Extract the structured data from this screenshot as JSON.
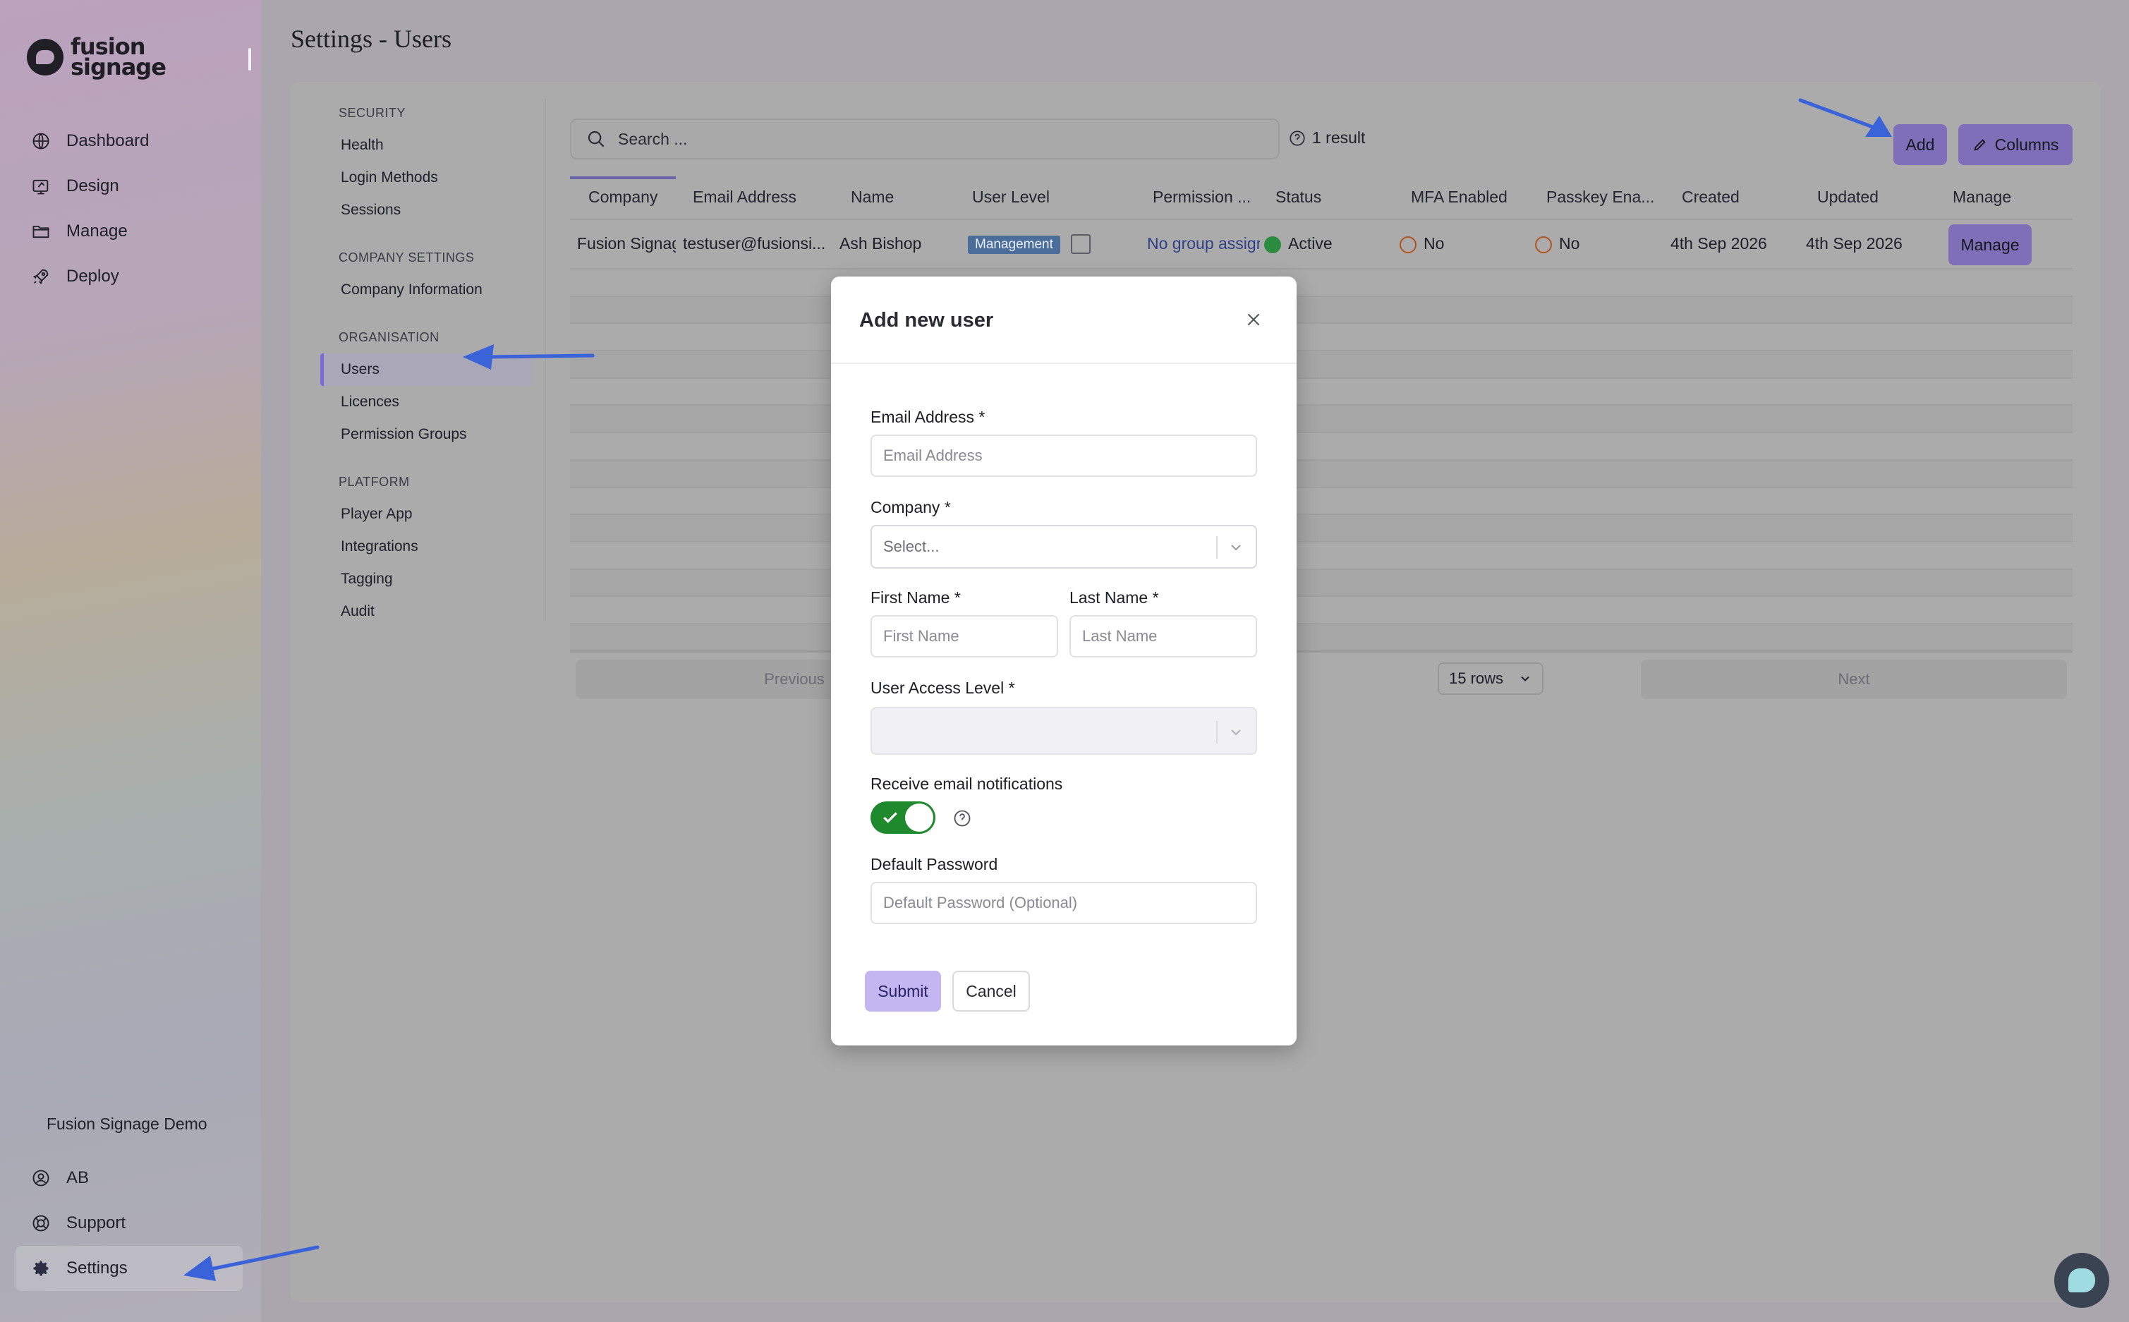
{
  "brand": {
    "line1": "fusion",
    "line2": "signage"
  },
  "nav": {
    "items": [
      {
        "label": "Dashboard",
        "icon": "globe-icon"
      },
      {
        "label": "Design",
        "icon": "design-icon"
      },
      {
        "label": "Manage",
        "icon": "folder-icon"
      },
      {
        "label": "Deploy",
        "icon": "rocket-icon"
      }
    ],
    "org_name": "Fusion Signage Demo",
    "bottom": [
      {
        "label": "AB",
        "icon": "user-circle-icon"
      },
      {
        "label": "Support",
        "icon": "lifebuoy-icon"
      },
      {
        "label": "Settings",
        "icon": "gear-icon"
      }
    ]
  },
  "page": {
    "title": "Settings - Users"
  },
  "settings_nav": {
    "security": {
      "heading": "SECURITY",
      "items": [
        "Health",
        "Login Methods",
        "Sessions"
      ]
    },
    "company": {
      "heading": "COMPANY SETTINGS",
      "items": [
        "Company Information"
      ]
    },
    "organisation": {
      "heading": "ORGANISATION",
      "items": [
        "Users",
        "Licences",
        "Permission Groups"
      ]
    },
    "platform": {
      "heading": "PLATFORM",
      "items": [
        "Player App",
        "Integrations",
        "Tagging",
        "Audit"
      ]
    }
  },
  "toolbar": {
    "search_placeholder": "Search ...",
    "result_count": "1 result",
    "add_label": "Add",
    "columns_label": "Columns"
  },
  "table": {
    "headers": [
      "Company",
      "Email Address",
      "Name",
      "User Level",
      "Permission ...",
      "Status",
      "MFA Enabled",
      "Passkey Ena...",
      "Created",
      "Updated",
      "Manage"
    ],
    "row": {
      "company": "Fusion Signage",
      "email": "testuser@fusionsi...",
      "name": "Ash Bishop",
      "user_level": "Management",
      "permission": "No group assigned",
      "status": "Active",
      "mfa": "No",
      "passkey": "No",
      "created": "4th Sep 2026",
      "updated": "4th Sep 2026",
      "manage_label": "Manage"
    },
    "status_color": "#2b8b3f"
  },
  "pager": {
    "previous": "Previous",
    "rows": "15 rows",
    "next": "Next"
  },
  "modal": {
    "title": "Add new user",
    "email_label": "Email Address *",
    "email_placeholder": "Email Address",
    "company_label": "Company *",
    "company_placeholder": "Select...",
    "first_name_label": "First Name *",
    "first_name_placeholder": "First Name",
    "last_name_label": "Last Name *",
    "last_name_placeholder": "Last Name",
    "access_level_label": "User Access Level *",
    "notifications_label": "Receive email notifications",
    "notifications_on": true,
    "password_label": "Default Password",
    "password_placeholder": "Default Password (Optional)",
    "submit_label": "Submit",
    "cancel_label": "Cancel"
  },
  "colors": {
    "accent": "#7d6fb8",
    "toggle_on": "#1f8a2d",
    "arrow": "#3b63d9"
  }
}
